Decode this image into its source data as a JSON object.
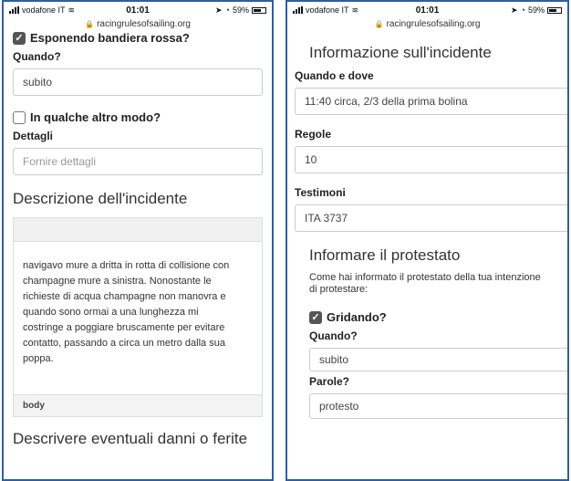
{
  "status": {
    "carrier": "vodafone IT",
    "time": "01:01",
    "battery": "59%",
    "domain": "racingrulesofsailing.org"
  },
  "left": {
    "checkbox_red_flag": "Esponendo bandiera rossa?",
    "when_label": "Quando?",
    "when_value": "subito",
    "checkbox_other": "In qualche altro modo?",
    "details_label": "Dettagli",
    "details_placeholder": "Fornire dettagli",
    "description_heading": "Descrizione dell'incidente",
    "description_text": "navigavo mure a dritta in rotta di collisione con\nchampagne mure a sinistra. Nonostante le\nrichieste di acqua champagne non manovra e\nquando sono ormai a una lunghezza mi\ncostringe a poggiare bruscamente per evitare\ncontatto, passando a circa un metro dalla sua\npoppa.",
    "editor_footer": "body",
    "damage_heading": "Descrivere eventuali danni o ferite"
  },
  "right": {
    "info_heading": "Informazione sull'incidente",
    "where_label": "Quando e dove",
    "where_value": "11:40 circa, 2/3 della prima bolina",
    "rules_label": "Regole",
    "rules_value": "10",
    "witness_label": "Testimoni",
    "witness_value": "ITA 3737",
    "inform_heading": "Informare il protestato",
    "inform_note_1": "Come hai informato il protestato della tua intenzione",
    "inform_note_2": "di protestare:",
    "checkbox_shout": "Gridando?",
    "when_label": "Quando?",
    "when_value": "subito",
    "words_label": "Parole?",
    "words_value": "protesto"
  }
}
